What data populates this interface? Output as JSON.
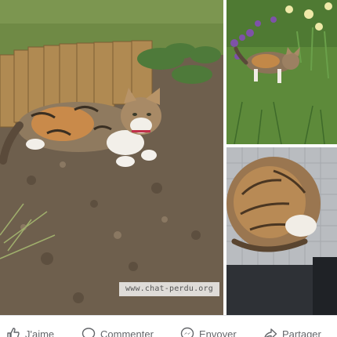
{
  "post": {
    "watermark": "www.chat-perdu.org",
    "photos": [
      {
        "subject": "tabby-calico cat lying on soil by wooden border"
      },
      {
        "subject": "tabby cat walking among flowers"
      },
      {
        "subject": "tabby cat curled up on grey cushion"
      }
    ]
  },
  "actions": {
    "like_label": "J'aime",
    "comment_label": "Commenter",
    "send_label": "Envoyer",
    "share_label": "Partager"
  },
  "icons": {
    "like": "thumbs-up-icon",
    "comment": "speech-bubble-icon",
    "send": "messenger-icon",
    "share": "share-arrow-icon"
  },
  "colors": {
    "action_text": "#65676b",
    "divider": "#e4e6ea"
  }
}
